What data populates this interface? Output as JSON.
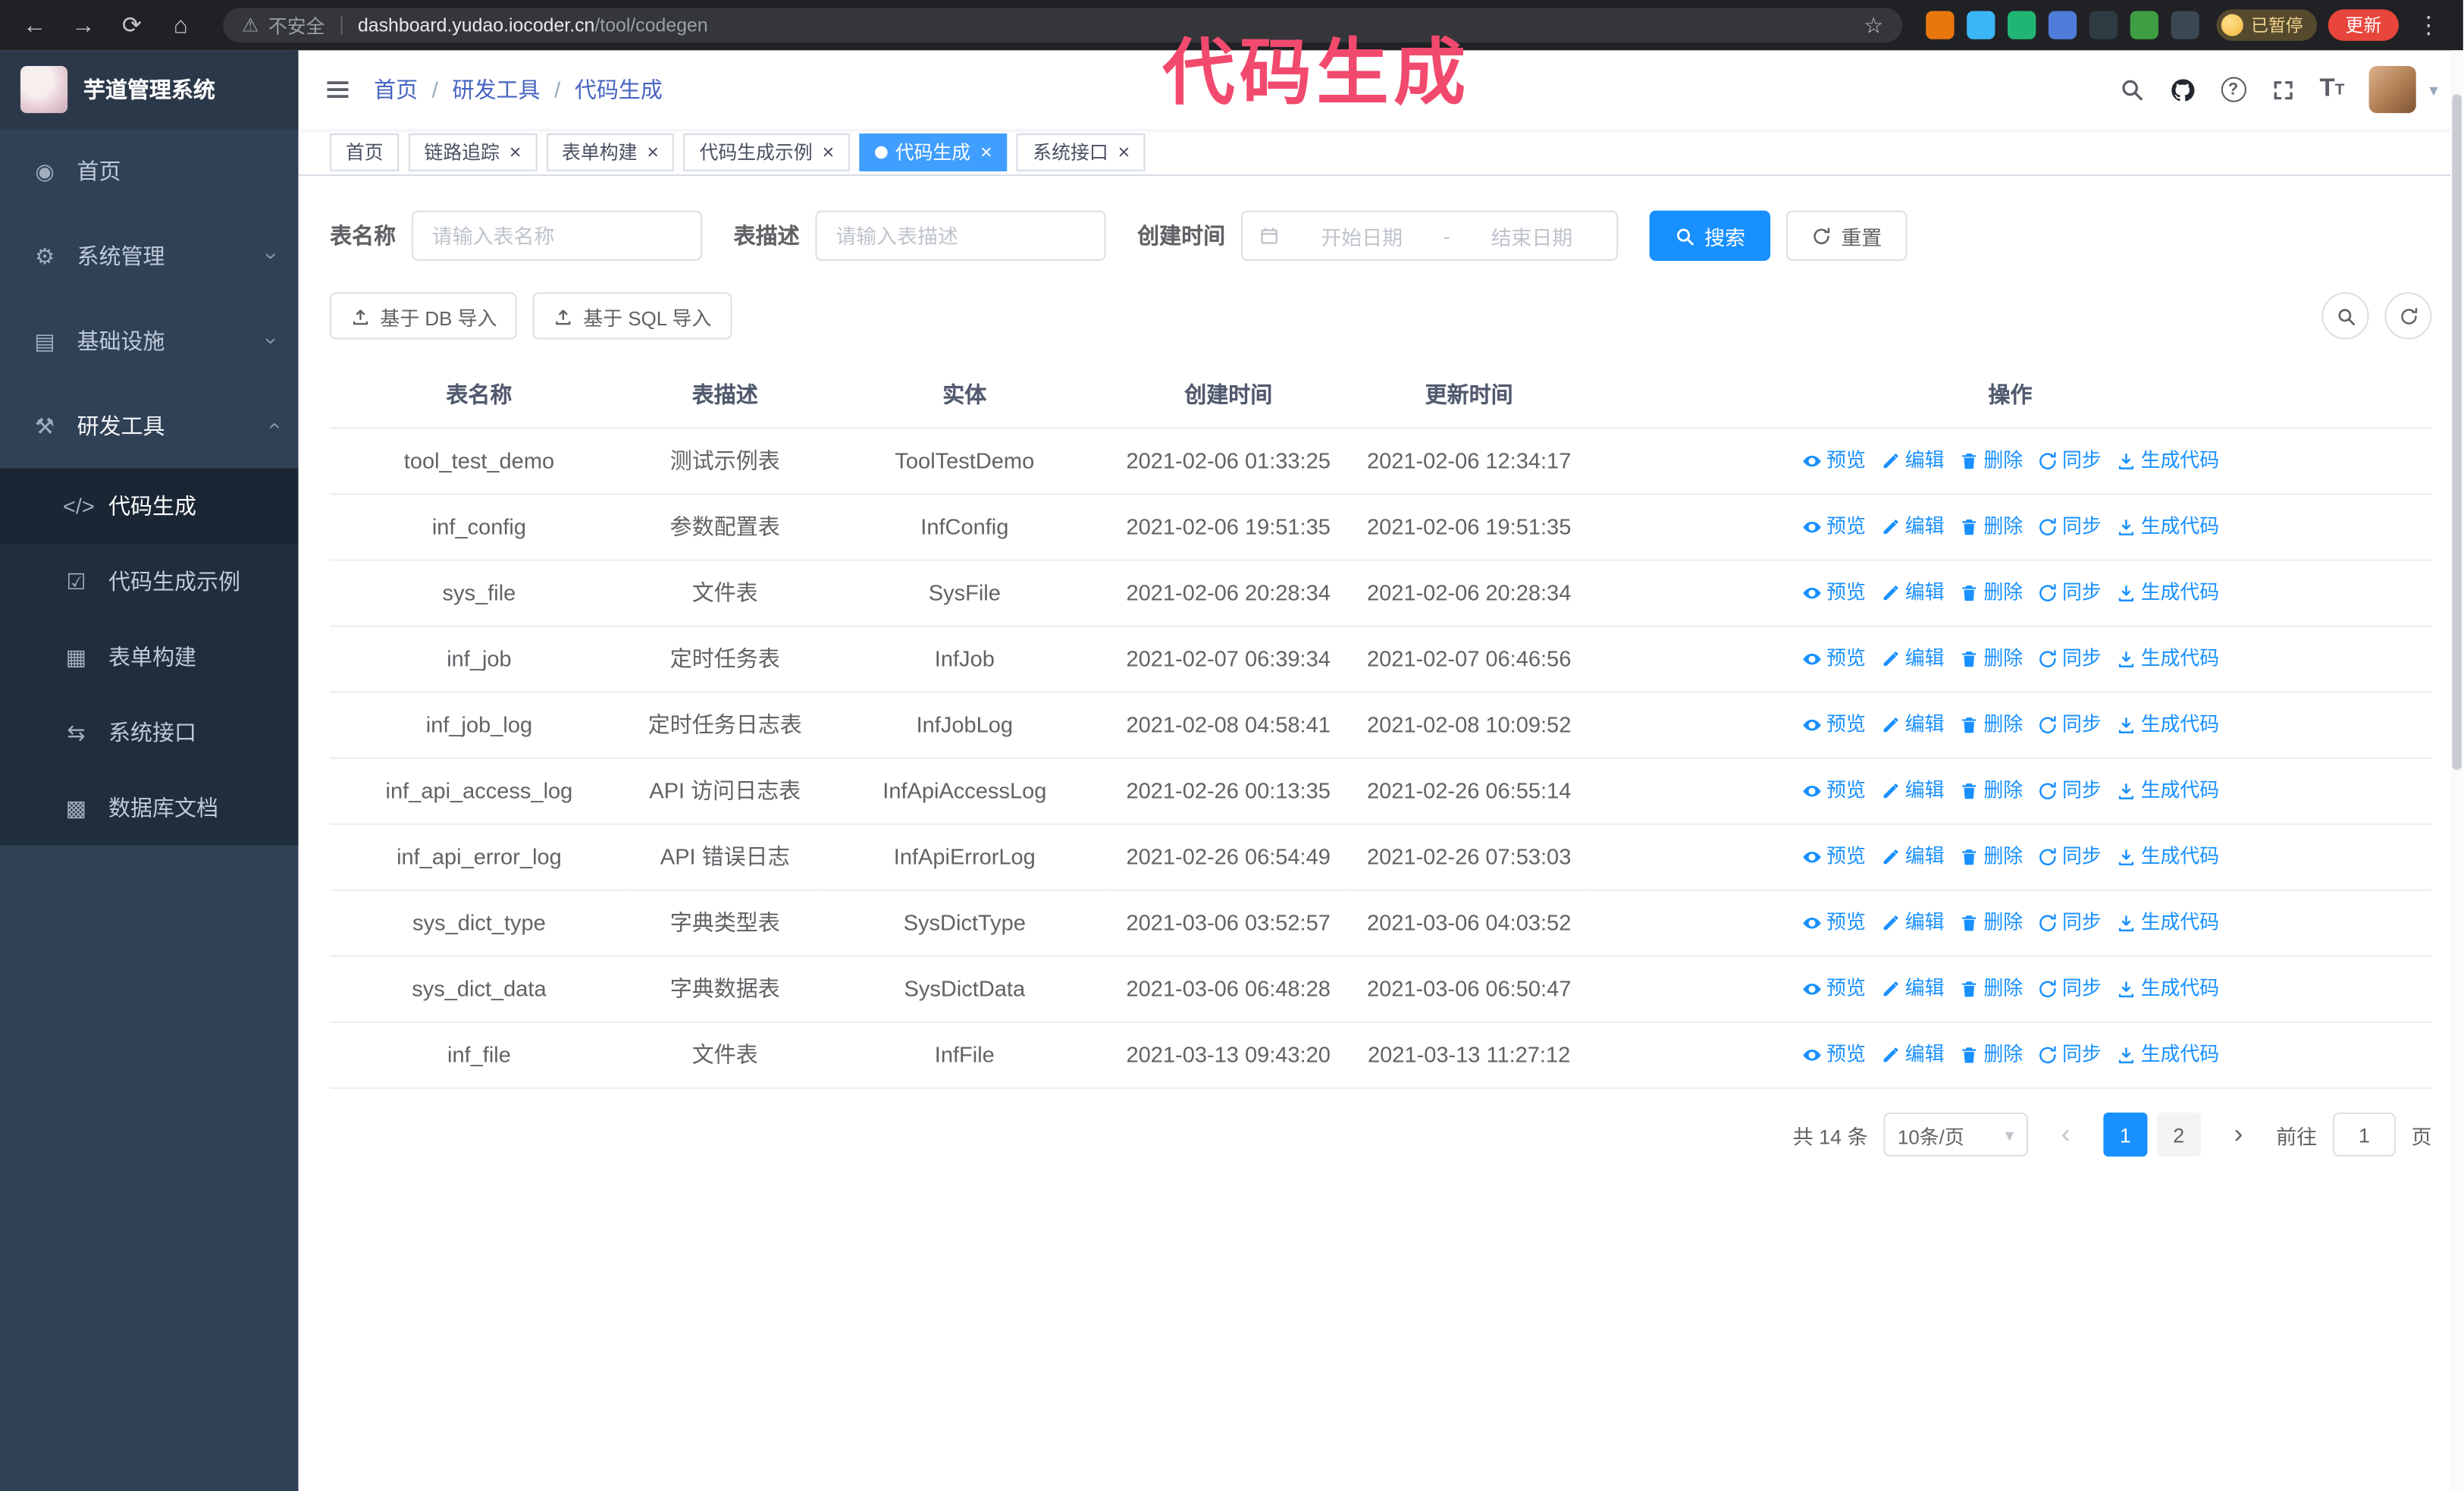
{
  "colors": {
    "primary": "#1890ff",
    "tab-active": "#409eff",
    "annotation": "#f24a6e"
  },
  "annotation": {
    "text": "代码生成"
  },
  "browser": {
    "insecure_label": "不安全",
    "url_host": "dashboard.yudao.iocoder.cn",
    "url_path": "/tool/codegen",
    "paused_badge": "已暂停",
    "update_button": "更新",
    "extensions": [
      {
        "name": "fox-extension-icon",
        "color": "#e8770e"
      },
      {
        "name": "water-drop-extension-icon",
        "color": "#3ab5f5"
      },
      {
        "name": "green-check-extension-icon",
        "color": "#21b573"
      },
      {
        "name": "team-extension-icon",
        "color": "#4f7bd9"
      },
      {
        "name": "chart-extension-icon",
        "color": "#2e3b43"
      },
      {
        "name": "leaf-extension-icon",
        "color": "#3f9d44"
      },
      {
        "name": "pin-extension-icon",
        "color": "#3b4752"
      }
    ]
  },
  "icons": {
    "back": "←",
    "forward": "→",
    "reload": "⟳",
    "home": "⌂",
    "warning": "⚠",
    "star": "☆",
    "more": "⋮",
    "home_menu": "◉",
    "gear": "⚙",
    "infra": "▤",
    "tools": "⚒",
    "code": "</>",
    "shield": "☑",
    "form": "▦",
    "api": "⇆",
    "db": "▩",
    "chevron": "›",
    "caret": "▾",
    "help": "?",
    "size_large": "T",
    "size_small": "T",
    "close": "×",
    "prev": "‹",
    "next": "›"
  },
  "sidebar": {
    "logo_title": "芋道管理系统",
    "items": [
      {
        "label": "首页",
        "icon": "home_menu",
        "icon_name": "dashboard-icon"
      },
      {
        "label": "系统管理",
        "icon": "gear",
        "icon_name": "gear-icon",
        "expandable": true
      },
      {
        "label": "基础设施",
        "icon": "infra",
        "icon_name": "infrastructure-icon",
        "expandable": true
      },
      {
        "label": "研发工具",
        "icon": "tools",
        "icon_name": "tools-icon",
        "expandable": true,
        "expanded": true
      }
    ],
    "submenu": [
      {
        "label": "代码生成",
        "icon": "code",
        "icon_name": "code-icon",
        "active": true
      },
      {
        "label": "代码生成示例",
        "icon": "shield",
        "icon_name": "example-shield-icon"
      },
      {
        "label": "表单构建",
        "icon": "form",
        "icon_name": "form-builder-icon"
      },
      {
        "label": "系统接口",
        "icon": "api",
        "icon_name": "api-icon"
      },
      {
        "label": "数据库文档",
        "icon": "db",
        "icon_name": "database-doc-icon"
      }
    ]
  },
  "header": {
    "breadcrumb": [
      "首页",
      "研发工具",
      "代码生成"
    ]
  },
  "tabs": [
    {
      "label": "首页",
      "closable": false
    },
    {
      "label": "链路追踪",
      "closable": true
    },
    {
      "label": "表单构建",
      "closable": true
    },
    {
      "label": "代码生成示例",
      "closable": true
    },
    {
      "label": "代码生成",
      "closable": true,
      "active": true
    },
    {
      "label": "系统接口",
      "closable": true
    }
  ],
  "filters": {
    "table_name_label": "表名称",
    "table_name_placeholder": "请输入表名称",
    "table_desc_label": "表描述",
    "table_desc_placeholder": "请输入表描述",
    "create_time_label": "创建时间",
    "date_start_placeholder": "开始日期",
    "date_separator": "-",
    "date_end_placeholder": "结束日期",
    "search_button": "搜索",
    "reset_button": "重置"
  },
  "toolbar": {
    "import_db": "基于 DB 导入",
    "import_sql": "基于 SQL 导入"
  },
  "table": {
    "columns": [
      "表名称",
      "表描述",
      "实体",
      "创建时间",
      "更新时间",
      "操作"
    ],
    "actions": [
      {
        "label": "预览",
        "icon": "eye-icon"
      },
      {
        "label": "编辑",
        "icon": "edit-icon"
      },
      {
        "label": "删除",
        "icon": "trash-icon"
      },
      {
        "label": "同步",
        "icon": "sync-icon"
      },
      {
        "label": "生成代码",
        "icon": "download-icon"
      }
    ],
    "rows": [
      {
        "name": "tool_test_demo",
        "desc": "测试示例表",
        "entity": "ToolTestDemo",
        "created": "2021-02-06 01:33:25",
        "updated": "2021-02-06 12:34:17"
      },
      {
        "name": "inf_config",
        "desc": "参数配置表",
        "entity": "InfConfig",
        "created": "2021-02-06 19:51:35",
        "updated": "2021-02-06 19:51:35"
      },
      {
        "name": "sys_file",
        "desc": "文件表",
        "entity": "SysFile",
        "created": "2021-02-06 20:28:34",
        "updated": "2021-02-06 20:28:34"
      },
      {
        "name": "inf_job",
        "desc": "定时任务表",
        "entity": "InfJob",
        "created": "2021-02-07 06:39:34",
        "updated": "2021-02-07 06:46:56"
      },
      {
        "name": "inf_job_log",
        "desc": "定时任务日志表",
        "entity": "InfJobLog",
        "created": "2021-02-08 04:58:41",
        "updated": "2021-02-08 10:09:52"
      },
      {
        "name": "inf_api_access_log",
        "desc": "API 访问日志表",
        "entity": "InfApiAccessLog",
        "created": "2021-02-26 00:13:35",
        "updated": "2021-02-26 06:55:14"
      },
      {
        "name": "inf_api_error_log",
        "desc": "API 错误日志",
        "entity": "InfApiErrorLog",
        "created": "2021-02-26 06:54:49",
        "updated": "2021-02-26 07:53:03"
      },
      {
        "name": "sys_dict_type",
        "desc": "字典类型表",
        "entity": "SysDictType",
        "created": "2021-03-06 03:52:57",
        "updated": "2021-03-06 04:03:52"
      },
      {
        "name": "sys_dict_data",
        "desc": "字典数据表",
        "entity": "SysDictData",
        "created": "2021-03-06 06:48:28",
        "updated": "2021-03-06 06:50:47"
      },
      {
        "name": "inf_file",
        "desc": "文件表",
        "entity": "InfFile",
        "created": "2021-03-13 09:43:20",
        "updated": "2021-03-13 11:27:12"
      }
    ]
  },
  "pagination": {
    "total": "共 14 条",
    "page_size": "10条/页",
    "pages": [
      "1",
      "2"
    ],
    "current": "1",
    "goto_label": "前往",
    "goto_value": "1",
    "goto_suffix": "页"
  }
}
